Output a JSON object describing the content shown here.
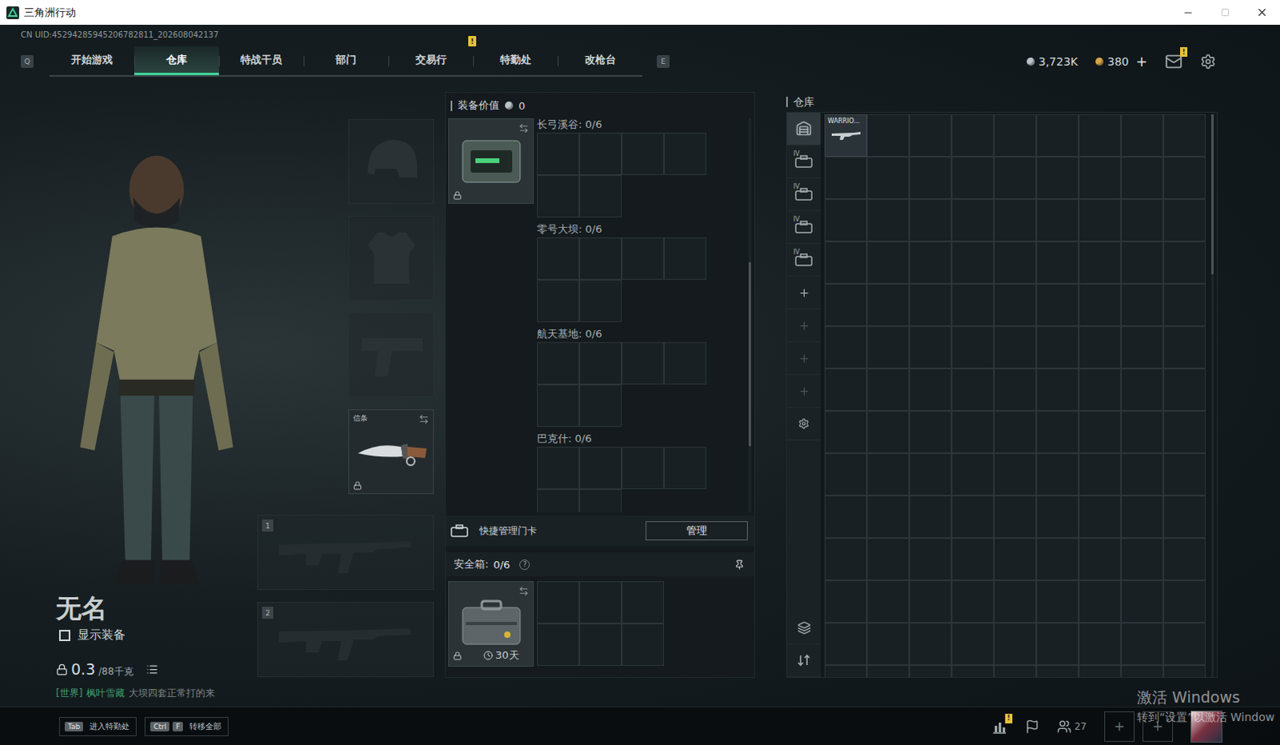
{
  "window": {
    "title": "三角洲行动"
  },
  "uid": "CN UID:45294285945206782811_202608042137",
  "nav": {
    "left_key": "Q",
    "right_key": "E",
    "tabs": [
      {
        "label": "开始游戏",
        "selected": false,
        "badge": ""
      },
      {
        "label": "仓库",
        "selected": true,
        "badge": ""
      },
      {
        "label": "特战干员",
        "selected": false,
        "badge": ""
      },
      {
        "label": "部门",
        "selected": false,
        "badge": ""
      },
      {
        "label": "交易行",
        "selected": false,
        "badge": ""
      },
      {
        "label": "特勤处",
        "selected": false,
        "badge": "!"
      },
      {
        "label": "改枪台",
        "selected": false,
        "badge": ""
      }
    ]
  },
  "currency": [
    {
      "value": "3,723K",
      "add": "",
      "color": "#b9c3c8"
    },
    {
      "value": "380",
      "add": "+",
      "color": "#d6a64a"
    }
  ],
  "mail": {
    "badge": "!"
  },
  "character": {
    "name": "无名",
    "show_gear": {
      "label": "显示装备",
      "checked": false
    },
    "weight": "0.3",
    "weight_max": "/88千克",
    "chat": {
      "channel": "[世界]",
      "sender": "枫叶雪藏",
      "message": "大坝四套正常打的来"
    }
  },
  "gear_slots": [
    {
      "kind": "helmet",
      "label": "",
      "filled": false,
      "locked": false
    },
    {
      "kind": "armor",
      "label": "",
      "filled": false,
      "locked": false
    },
    {
      "kind": "pistol",
      "label": "",
      "filled": false,
      "locked": false
    },
    {
      "kind": "melee",
      "label": "信条",
      "filled": true,
      "locked": true
    }
  ],
  "weapons": [
    {
      "number": "1",
      "filled": false
    },
    {
      "number": "2",
      "filled": false
    }
  ],
  "equipment_value": {
    "label": "装备价值",
    "value": "0"
  },
  "keycard_case": {
    "locked": true,
    "maps": [
      {
        "label": "长弓溪谷: 0/6"
      },
      {
        "label": "零号大坝: 0/6"
      },
      {
        "label": "航天基地: 0/6"
      },
      {
        "label": "巴克什: 0/6"
      }
    ]
  },
  "quick_cards": {
    "label": "快捷管理门卡",
    "button": "管理"
  },
  "safe_box": {
    "label": "安全箱:",
    "count": "0/6",
    "help": "?",
    "duration": "30天",
    "locked": true
  },
  "warehouse": {
    "title": "仓库",
    "sidebar": [
      {
        "kind": "home",
        "label": "",
        "selected": true,
        "disabled": false
      },
      {
        "kind": "case",
        "label": "IV",
        "selected": false,
        "disabled": false
      },
      {
        "kind": "case",
        "label": "IV",
        "selected": false,
        "disabled": false
      },
      {
        "kind": "case",
        "label": "IV",
        "selected": false,
        "disabled": false
      },
      {
        "kind": "case",
        "label": "IV",
        "selected": false,
        "disabled": false
      },
      {
        "kind": "add",
        "label": "",
        "selected": false,
        "disabled": false
      },
      {
        "kind": "add",
        "label": "",
        "selected": false,
        "disabled": true
      },
      {
        "kind": "add",
        "label": "",
        "selected": false,
        "disabled": true
      },
      {
        "kind": "add",
        "label": "",
        "selected": false,
        "disabled": true
      },
      {
        "kind": "settings",
        "label": "",
        "selected": false,
        "disabled": false
      }
    ],
    "sidebar_bottom": [
      {
        "kind": "layers"
      },
      {
        "kind": "sort"
      }
    ],
    "items": [
      {
        "name": "WARRIO..."
      }
    ]
  },
  "hints": [
    {
      "keys": [
        "Tab"
      ],
      "label": "进入特勤处"
    },
    {
      "keys": [
        "Ctrl",
        "F"
      ],
      "label": "转移全部"
    }
  ],
  "social": {
    "stats_badge": "!",
    "friends": "27",
    "party_slots": [
      {
        "empty": true
      },
      {
        "empty": true
      }
    ]
  },
  "watermark": {
    "title": "激活 Windows",
    "subtitle": "转到“设置”以激活 Window"
  }
}
